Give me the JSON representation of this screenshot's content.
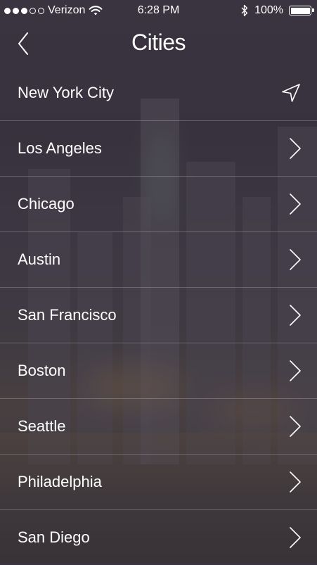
{
  "status_bar": {
    "carrier": "Verizon",
    "time": "6:28 PM",
    "battery_percent": "100%"
  },
  "nav": {
    "title": "Cities"
  },
  "cities": [
    {
      "label": "New York City",
      "icon": "location-arrow-icon"
    },
    {
      "label": "Los Angeles",
      "icon": "chevron-right-icon"
    },
    {
      "label": "Chicago",
      "icon": "chevron-right-icon"
    },
    {
      "label": "Austin",
      "icon": "chevron-right-icon"
    },
    {
      "label": "San Francisco",
      "icon": "chevron-right-icon"
    },
    {
      "label": "Boston",
      "icon": "chevron-right-icon"
    },
    {
      "label": "Seattle",
      "icon": "chevron-right-icon"
    },
    {
      "label": "Philadelphia",
      "icon": "chevron-right-icon"
    },
    {
      "label": "San Diego",
      "icon": "chevron-right-icon"
    }
  ],
  "colors": {
    "overlay": "#342e3a",
    "text": "#ffffff",
    "separator": "#ffffff"
  }
}
